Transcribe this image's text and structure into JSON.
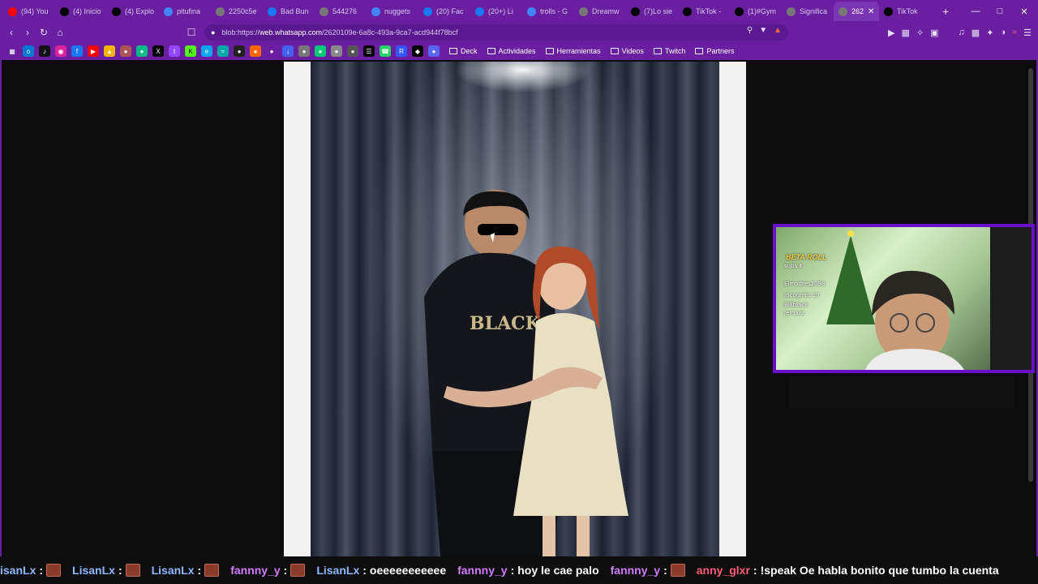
{
  "tabs": [
    {
      "label": "(94) You",
      "favicon_color": "#ff0000",
      "icon": "youtube-icon"
    },
    {
      "label": "(4) Inicio",
      "favicon_color": "#000000",
      "icon": "x-icon"
    },
    {
      "label": "(4) Explo",
      "favicon_color": "#000000",
      "icon": "x-icon"
    },
    {
      "label": "pitufina",
      "favicon_color": "#4285f4",
      "icon": "google-icon"
    },
    {
      "label": "2250c5e",
      "favicon_color": "#777777",
      "icon": "globe-icon"
    },
    {
      "label": "Bad Bun",
      "favicon_color": "#1877f2",
      "icon": "facebook-icon"
    },
    {
      "label": "544276",
      "favicon_color": "#777777",
      "icon": "globe-icon"
    },
    {
      "label": "nuggets",
      "favicon_color": "#4285f4",
      "icon": "google-icon"
    },
    {
      "label": "(20) Fac",
      "favicon_color": "#1877f2",
      "icon": "facebook-icon"
    },
    {
      "label": "(20+) Li",
      "favicon_color": "#1877f2",
      "icon": "facebook-icon"
    },
    {
      "label": "trolls - G",
      "favicon_color": "#4285f4",
      "icon": "google-icon"
    },
    {
      "label": "Dreamw",
      "favicon_color": "#777777",
      "icon": "globe-icon"
    },
    {
      "label": "(7)Lo sie",
      "favicon_color": "#000000",
      "icon": "tiktok-icon"
    },
    {
      "label": "TikTok -",
      "favicon_color": "#000000",
      "icon": "tiktok-icon"
    },
    {
      "label": "(1)#Gym",
      "favicon_color": "#000000",
      "icon": "tiktok-icon"
    },
    {
      "label": "Significa",
      "favicon_color": "#777777",
      "icon": "globe-icon"
    },
    {
      "label": "262",
      "favicon_color": "#777777",
      "icon": "globe-icon",
      "active": true
    },
    {
      "label": "TikTok",
      "favicon_color": "#000000",
      "icon": "tiktok-icon"
    }
  ],
  "address": {
    "url_prefix": "blob:https://",
    "url_host": "web.whatsapp.com",
    "url_path": "/2620109e-6a8c-493a-9ca7-acd944f78bcf"
  },
  "bookmark_folders": [
    {
      "label": "Deck"
    },
    {
      "label": "Actividades"
    },
    {
      "label": "Herramientas"
    },
    {
      "label": "Videos"
    },
    {
      "label": "Twitch"
    },
    {
      "label": "Partners"
    }
  ],
  "webcam": {
    "title": "BETA ROLL",
    "lines": [
      "subs K",
      "Elmodres2098",
      "Incognito 10",
      "Billblack",
      "Jemazz"
    ]
  },
  "chat": [
    {
      "user": "isanLx",
      "sep": ":",
      "text": "",
      "emote": true,
      "color": "#8fb7ff"
    },
    {
      "user": "LisanLx",
      "sep": ":",
      "text": "",
      "emote": true,
      "color": "#8fb7ff"
    },
    {
      "user": "LisanLx",
      "sep": ":",
      "text": "",
      "emote": true,
      "color": "#8fb7ff"
    },
    {
      "user": "fannny_y",
      "sep": ":",
      "text": "",
      "emote": true,
      "color": "#d17cff"
    },
    {
      "user": "LisanLx",
      "sep": ":",
      "text": "oeeeeeeeeeee",
      "emote": false,
      "color": "#8fb7ff"
    },
    {
      "user": "fannny_y",
      "sep": ":",
      "text": "hoy le cae palo",
      "emote": false,
      "color": "#d17cff"
    },
    {
      "user": "fannny_y",
      "sep": ":",
      "text": "",
      "emote": true,
      "color": "#d17cff"
    },
    {
      "user": "anny_glxr",
      "sep": ":",
      "text": "!speak Oe habla bonito que tumbo la cuenta",
      "emote": false,
      "color": "#ff5c7a"
    }
  ],
  "colors": {
    "browser_chrome": "#6a1fa0",
    "cam_border": "#6a10c9"
  }
}
